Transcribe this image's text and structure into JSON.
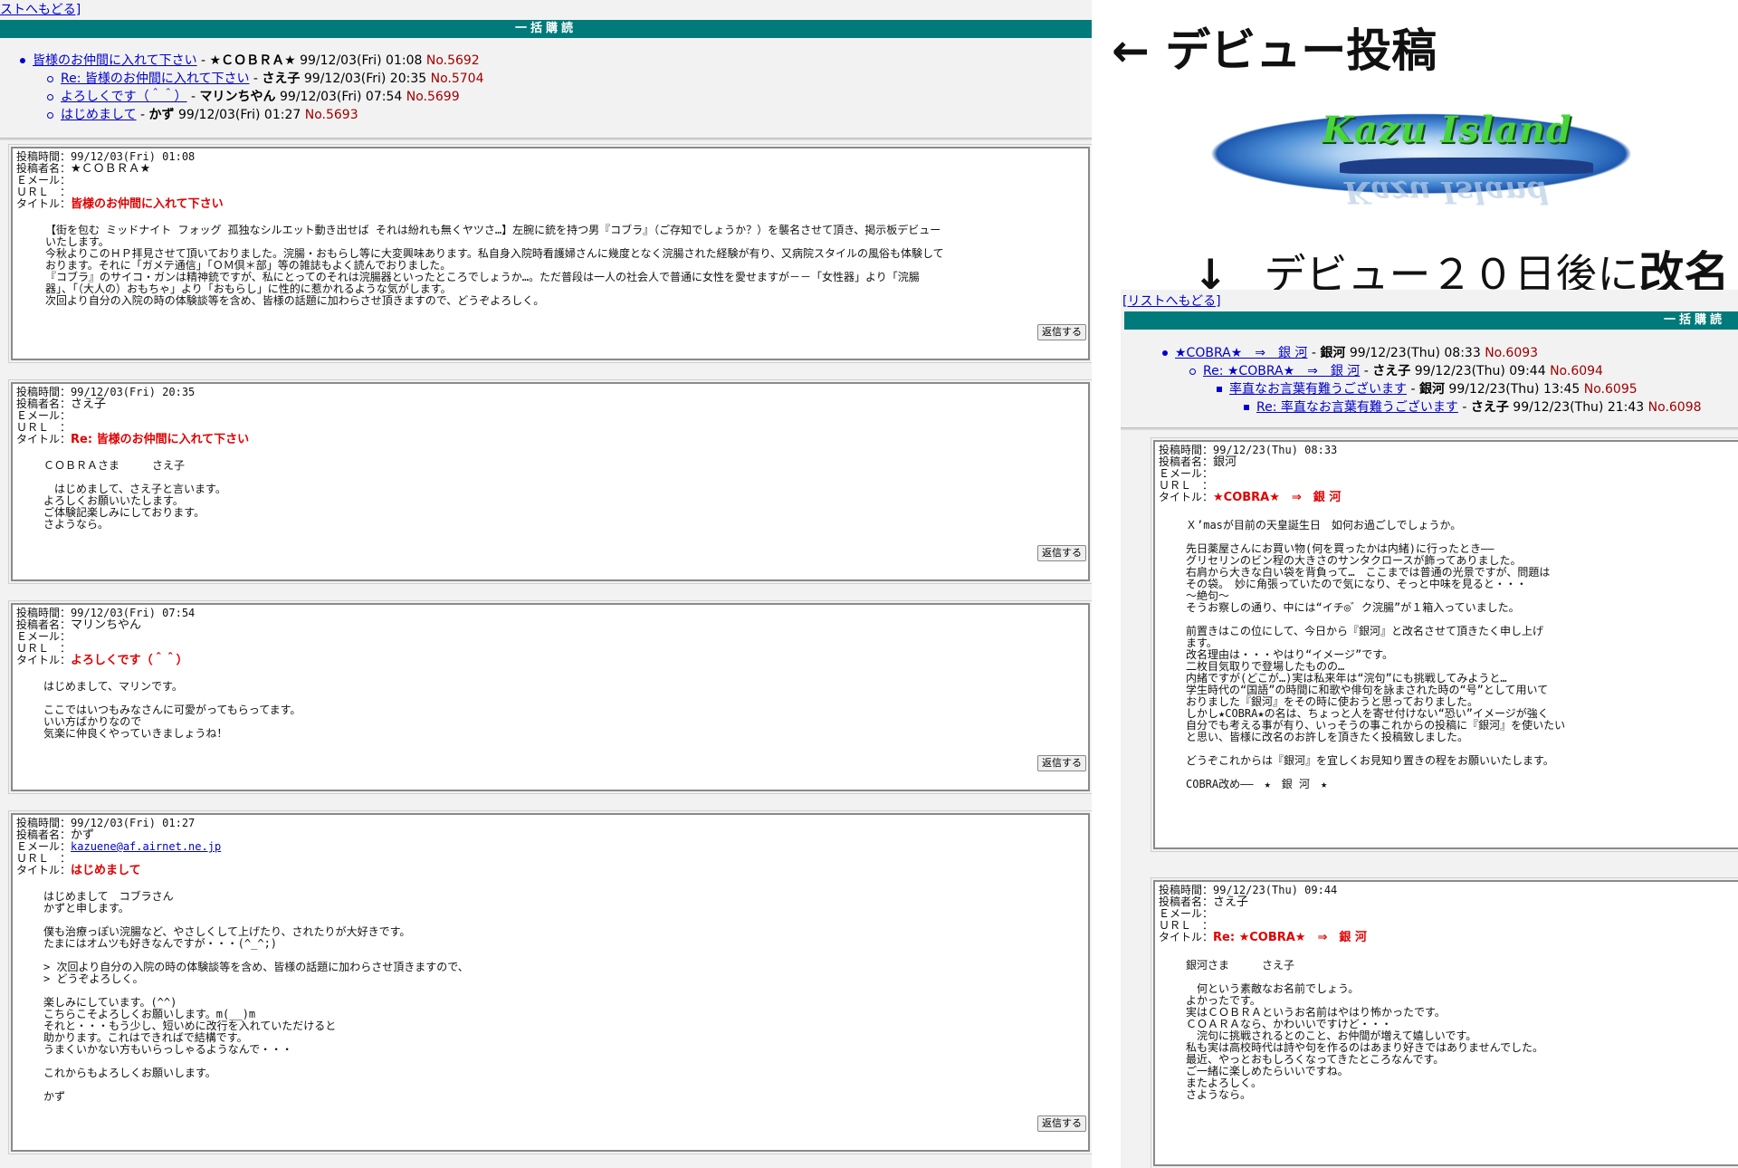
{
  "left": {
    "back_link": "ストへもどる]",
    "header": "一括購読",
    "tree": [
      {
        "title": "皆様のお仲間に入れて下さい",
        "author": "★ＣＯＢＲＡ★",
        "date": "99/12/03(Fri) 01:08",
        "no": "No.5692"
      },
      {
        "title": "Re: 皆様のお仲間に入れて下さい",
        "author": "さえ子",
        "date": "99/12/03(Fri) 20:35",
        "no": "No.5704"
      },
      {
        "title": "よろしくです（＾＾）",
        "author": "マリンちやん",
        "date": "99/12/03(Fri) 07:54",
        "no": "No.5699"
      },
      {
        "title": "はじめまして",
        "author": "かず",
        "date": "99/12/03(Fri) 01:27",
        "no": "No.5693"
      }
    ],
    "posts": [
      {
        "time_label": "投稿時間：99/12/03(Fri) 01:08",
        "name_label": "投稿者名：",
        "name": "★ＣＯＢＲＡ★",
        "email_label": "Ｅメール：",
        "email": "",
        "url_label": "ＵＲＬ　：",
        "title_label": "タイトル：",
        "title": "皆様のお仲間に入れて下さい",
        "body": "【街を包む ミッドナイト フォッグ 孤独なシルエット動き出せば それは紛れも無くヤツさ…】左腕に銃を持つ男『コブラ』（ご存知でしょうか？）を襲名させて頂き、掲示板デビュー\nいたします。\n今秋よりこのＨＰ拝見させて頂いておりました。浣腸・おもらし等に大変興味あります。私自身入院時看護婦さんに幾度となく浣腸された経験が有り、又病院スタイルの風俗も体験して\nおります。それに「ガメテ通信」「ＯＭ倶＊部」等の雑誌もよく読んでおりました。\n『コブラ』のサイコ・ガンは精神銃ですが、私にとってのそれは浣腸器といったところでしょうか…。ただ普段は一人の社会人で普通に女性を愛せますが－－「女性器」より「浣腸\n器」、「（大人の）おもちゃ」より「おもらし」に性的に惹かれるような気がします。\n次回より自分の入院の時の体験談等を含め、皆様の話題に加わらさせ頂きますので、どうぞよろしく。",
        "reply": "返信する"
      },
      {
        "time_label": "投稿時間：99/12/03(Fri) 20:35",
        "name_label": "投稿者名：",
        "name": "さえ子",
        "email_label": "Ｅメール：",
        "email": "",
        "url_label": "ＵＲＬ　：",
        "title_label": "タイトル：",
        "title": "Re: 皆様のお仲間に入れて下さい",
        "body": "ＣＯＢＲＡさま　　　さえ子\n\n　はじめまして、さえ子と言います。\nよろしくお願いいたします。\nご体験記楽しみにしております。\nさようなら。",
        "reply": "返信する"
      },
      {
        "time_label": "投稿時間：99/12/03(Fri) 07:54",
        "name_label": "投稿者名：",
        "name": "マリンちやん",
        "email_label": "Ｅメール：",
        "email": "",
        "url_label": "ＵＲＬ　：",
        "title_label": "タイトル：",
        "title": "よろしくです（＾＾）",
        "body": "はじめまして、マリンです。\n\nここではいつもみなさんに可愛がってもらってます。\nいい方ばかりなので\n気楽に仲良くやっていきましょうね！",
        "reply": "返信する"
      },
      {
        "time_label": "投稿時間：99/12/03(Fri) 01:27",
        "name_label": "投稿者名：",
        "name": "かず",
        "email_label": "Ｅメール：",
        "email": "kazuene@af.airnet.ne.jp",
        "url_label": "ＵＲＬ　：",
        "title_label": "タイトル：",
        "title": "はじめまして",
        "body": "はじめまして　コブラさん\nかずと申します。\n\n僕も治療っぽい浣腸など、やさしくして上げたり、されたりが大好きです。\nたまにはオムツも好きなんですが・・・(^_^;)\n\n> 次回より自分の入院の時の体験談等を含め、皆様の話題に加わらさせ頂きますので、\n> どうぞよろしく。\n\n楽しみにしています。(^^)\nこちらこそよろしくお願いします。m(__)m\nそれと・・・もう少し、短いめに改行を入れていただけると\n助かります。これはできればで結構です。\nうまくいかない方もいらっしゃるようなんで・・・\n\nこれからもよろしくお願いします。\n\nかず",
        "reply": "返信する"
      }
    ]
  },
  "annotations": {
    "debut": "← デビュー投稿",
    "rename_arrow": "↓",
    "rename_a": "デビュー２０日後に",
    "rename_b": "改名"
  },
  "banner": {
    "logo_text": "Kazu Island"
  },
  "right": {
    "back_link": "[リストへもどる]",
    "header": "一括購読",
    "tree": [
      {
        "title": "★COBRA★　⇒　銀 河",
        "author": "銀河",
        "date": "99/12/23(Thu) 08:33",
        "no": "No.6093"
      },
      {
        "title": "Re: ★COBRA★　⇒　銀 河",
        "author": "さえ子",
        "date": "99/12/23(Thu) 09:44",
        "no": "No.6094"
      },
      {
        "title": "率直なお言葉有難うございます",
        "author": "銀河",
        "date": "99/12/23(Thu) 13:45",
        "no": "No.6095"
      },
      {
        "title": "Re: 率直なお言葉有難うございます",
        "author": "さえ子",
        "date": "99/12/23(Thu) 21:43",
        "no": "No.6098"
      }
    ],
    "posts": [
      {
        "time_label": "投稿時間：99/12/23(Thu) 08:33",
        "name_label": "投稿者名：",
        "name": "銀河",
        "email_label": "Ｅメール：",
        "url_label": "ＵＲＬ　：",
        "title_label": "タイトル：",
        "title": "★COBRA★　⇒　銀 河",
        "body": "Ｘ’masが目前の天皇誕生日　如何お過ごしでしょうか。\n\n先日薬屋さんにお買い物(何を買ったかは内緒)に行ったとき――\nグリセリンのビン程の大きさのサンタクロースが飾ってありました。\n右肩から大きな白い袋を背負って…　ここまでは普通の光景ですが、問題は\nその袋。　妙に角張っていたので気になり、そっと中味を見ると・・・\n～絶句～\nそうお察しの通り、中には“イチ◎゛ク浣腸”が１箱入っていました。\n\n前置きはこの位にして、今日から『銀河』と改名させて頂きたく申し上げ\nます。\n改名理由は・・・やはり“イメージ”です。\n二枚目気取りで登場したものの…\n内緒ですが(どこが…)実は私来年は“浣句”にも挑戦してみようと…\n学生時代の“国語”の時間に和歌や俳句を詠まされた時の“号”として用いて\nおりました『銀河』をその時に使おうと思っておりました。\nしかし★COBRA★の名は、ちょっと人を寄せ付けない“恐い”イメージが強く\n自分でも考える事が有り、いっそうの事これからの投稿に『銀河』を使いたい\nと思い、皆様に改名のお許しを頂きたく投稿致しました。\n\nどうぞこれからは『銀河』を宜しくお見知り置きの程をお願いいたします。\n\nCOBRA改め――　★　銀 河　★"
      },
      {
        "time_label": "投稿時間：99/12/23(Thu) 09:44",
        "name_label": "投稿者名：",
        "name": "さえ子",
        "email_label": "Ｅメール：",
        "url_label": "ＵＲＬ　：",
        "title_label": "タイトル：",
        "title": "Re: ★COBRA★　⇒　銀 河",
        "body": "銀河さま　　　さえ子\n\n　何という素敵なお名前でしょう。\nよかったです。\n実はＣＯＢＲＡというお名前はやはり怖かったです。\nＣＯＡＲＡなら、かわいいですけど・・・\n　浣句に挑戦されるとのこと、お仲間が増えて嬉しいです。\n私も実は高校時代は詩や句を作るのはあまり好きではありませんでした。\n最近、やっとおもしろくなってきたところなんです。\nご一緒に楽しめたらいいですね。\nまたよろしく。\nさようなら。"
      }
    ]
  }
}
